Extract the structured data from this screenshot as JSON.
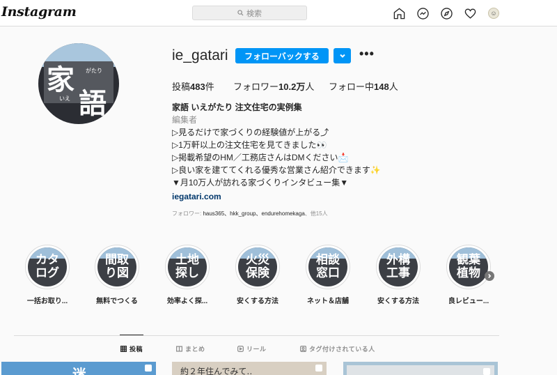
{
  "topbar": {
    "logo": "Instagram",
    "search_placeholder": "検索",
    "icons": [
      "home-icon",
      "messenger-icon",
      "explore-icon",
      "heart-icon",
      "avatar"
    ]
  },
  "profile": {
    "avatar_text": {
      "big1": "家",
      "big2": "語",
      "small1": "がたり",
      "small2": "いえ"
    },
    "username": "ie_gatari",
    "follow_button": "フォローバックする",
    "more": "•••",
    "stats": {
      "posts_label": "投稿",
      "posts_value": "483",
      "posts_unit": "件",
      "followers_label": "フォロワー",
      "followers_value": "10.2万",
      "followers_unit": "人",
      "following_label": "フォロー中",
      "following_value": "148",
      "following_unit": "人"
    },
    "bio": {
      "name": "家語 いえがたり 注文住宅の実例集",
      "category": "編集者",
      "lines": [
        "▷見るだけで家づくりの経験値が上がる⤴",
        "▷1万軒以上の注文住宅を見てきました👀",
        "▷掲載希望のHM／工務店さんはDMください📩",
        "▷良い家を建ててくれる優秀な営業さん紹介できます✨",
        "▼月10万人が訪れる家づくりインタビュー集▼"
      ],
      "link": "iegatari.com"
    },
    "followed_by": {
      "prefix": "フォロワー: ",
      "names": "haus365、hkk_group、endurehomekaga",
      "suffix": "、他15人"
    }
  },
  "highlights": [
    {
      "cover": "カタ\nログ",
      "label": "一括お取り..."
    },
    {
      "cover": "間取\nり図",
      "label": "無料でつくる"
    },
    {
      "cover": "土地\n探し",
      "label": "効率よく探..."
    },
    {
      "cover": "火災\n保険",
      "label": "安くする方法"
    },
    {
      "cover": "相談\n窓口",
      "label": "ネット＆店舗"
    },
    {
      "cover": "外構\n工事",
      "label": "安くする方法"
    },
    {
      "cover": "観葉\n植物",
      "label": "良レビュー..."
    }
  ],
  "tabs": [
    {
      "label": "投稿",
      "icon": "grid-icon",
      "active": true
    },
    {
      "label": "まとめ",
      "icon": "guide-icon",
      "active": false
    },
    {
      "label": "リール",
      "icon": "reels-icon",
      "active": false
    },
    {
      "label": "タグ付けされている人",
      "icon": "tag-icon",
      "active": false
    }
  ],
  "posts": [
    {
      "caption": "迷"
    },
    {
      "caption": "約２年住んでみて‥"
    },
    {
      "caption": ""
    }
  ],
  "colors": {
    "accent": "#0095f6",
    "link": "#00376b",
    "muted": "#8e8e8e"
  }
}
